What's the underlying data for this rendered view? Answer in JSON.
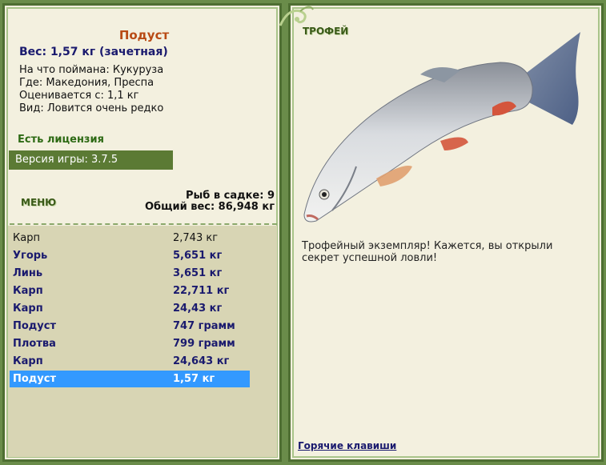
{
  "fish": {
    "name": "Подуст",
    "weight_line": "Вес: 1,57 кг (зачетная)",
    "bait": "На что поймана: Кукуруза",
    "location": "Где: Македония, Преспа",
    "rated_from": "Оценивается с: 1,1 кг",
    "rarity": "Вид: Ловится очень редко"
  },
  "license": "Есть лицензия",
  "version": "Версия игры: 3.7.5",
  "menu_label": "МЕНЮ",
  "keepnet": {
    "count_line": "Рыб в садке: 9",
    "total_line": "Общий вес: 86,948 кг"
  },
  "catch_list": [
    {
      "name": "Карп",
      "weight": "2,743 кг",
      "style": "plain"
    },
    {
      "name": "Угорь",
      "weight": "5,651 кг",
      "style": "bold"
    },
    {
      "name": "Линь",
      "weight": "3,651 кг",
      "style": "bold"
    },
    {
      "name": "Карп",
      "weight": "22,711 кг",
      "style": "bold"
    },
    {
      "name": "Карп",
      "weight": "24,43 кг",
      "style": "bold"
    },
    {
      "name": "Подуст",
      "weight": "747 грамм",
      "style": "bold"
    },
    {
      "name": "Плотва",
      "weight": "799 грамм",
      "style": "bold"
    },
    {
      "name": "Карп",
      "weight": "24,643 кг",
      "style": "bold"
    },
    {
      "name": "Подуст",
      "weight": "1,57 кг",
      "style": "selected"
    }
  ],
  "trophy": {
    "label": "ТРОФЕЙ",
    "text": "Трофейный экземпляр! Кажется, вы открыли секрет успешной ловли!"
  },
  "hotkeys": "Горячие клавиши",
  "colors": {
    "frame_bg": "#6a8c4a",
    "panel_bg": "#f3f0df",
    "list_bg": "#d8d5b4",
    "selected": "#3399ff",
    "version_bar": "#5b7a34",
    "fish_name": "#b84a14"
  }
}
